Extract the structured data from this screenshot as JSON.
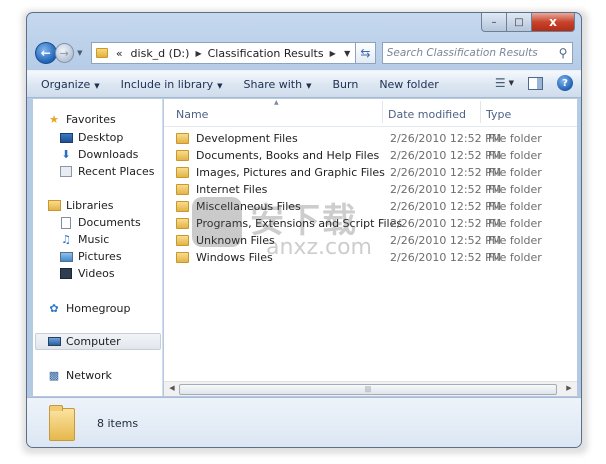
{
  "window": {
    "buttons": {
      "minimize": "–",
      "maximize": "□",
      "close": "x"
    }
  },
  "address": {
    "overflow": "«",
    "crumbs": [
      "disk_d (D:)",
      "Classification Results"
    ],
    "search_placeholder": "Search Classification Results"
  },
  "toolbar": {
    "items": [
      "Organize",
      "Include in library",
      "Share with",
      "Burn",
      "New folder"
    ]
  },
  "nav": {
    "favorites": {
      "label": "Favorites",
      "items": [
        "Desktop",
        "Downloads",
        "Recent Places"
      ]
    },
    "libraries": {
      "label": "Libraries",
      "items": [
        "Documents",
        "Music",
        "Pictures",
        "Videos"
      ]
    },
    "homegroup": "Homegroup",
    "computer": "Computer",
    "network": "Network",
    "selected": "Computer"
  },
  "columns": {
    "name": "Name",
    "date": "Date modified",
    "type": "Type"
  },
  "files": [
    {
      "name": "Development Files",
      "date": "2/26/2010 12:52 PM",
      "type": "File folder"
    },
    {
      "name": "Documents, Books and Help Files",
      "date": "2/26/2010 12:52 PM",
      "type": "File folder"
    },
    {
      "name": "Images, Pictures and Graphic Files",
      "date": "2/26/2010 12:52 PM",
      "type": "File folder"
    },
    {
      "name": "Internet Files",
      "date": "2/26/2010 12:52 PM",
      "type": "File folder"
    },
    {
      "name": "Miscellaneous Files",
      "date": "2/26/2010 12:52 PM",
      "type": "File folder"
    },
    {
      "name": "Programs, Extensions and Script Files",
      "date": "2/26/2010 12:52 PM",
      "type": "File folder"
    },
    {
      "name": "Unknown Files",
      "date": "2/26/2010 12:52 PM",
      "type": "File folder"
    },
    {
      "name": "Windows Files",
      "date": "2/26/2010 12:52 PM",
      "type": "File folder"
    }
  ],
  "status": {
    "count": "8 items"
  },
  "watermark": {
    "cn": "安下载",
    "en": "anxz.com"
  },
  "colors": {
    "accent": "#1f63b7",
    "folder": "#e3b448",
    "window_frame": "#b5cbe6"
  }
}
